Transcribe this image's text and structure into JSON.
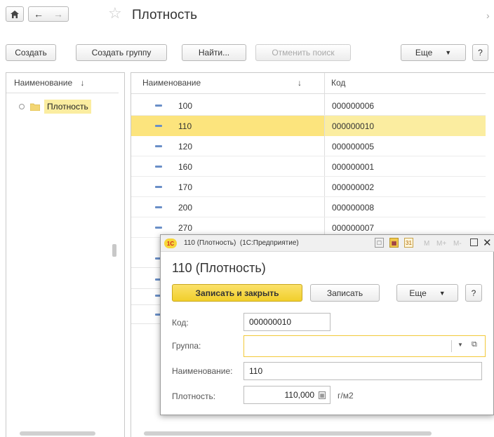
{
  "page": {
    "title": "Плотность"
  },
  "toolbar": {
    "create": "Создать",
    "create_group": "Создать группу",
    "find": "Найти...",
    "cancel_search": "Отменить поиск",
    "more": "Еще",
    "help": "?"
  },
  "tree": {
    "header": "Наименование",
    "sort_icon": "↓",
    "item": "Плотность"
  },
  "list": {
    "header_name": "Наименование",
    "header_sort": "↓",
    "header_code": "Код",
    "rows": [
      {
        "name": "100",
        "code": "000000006"
      },
      {
        "name": "110",
        "code": "000000010"
      },
      {
        "name": "120",
        "code": "000000005"
      },
      {
        "name": "160",
        "code": "000000001"
      },
      {
        "name": "170",
        "code": "000000002"
      },
      {
        "name": "200",
        "code": "000000008"
      },
      {
        "name": "270",
        "code": "000000007"
      }
    ]
  },
  "dialog": {
    "window_title": "110 (Плотность)  (1С:Предприятие)",
    "tb_m": "M",
    "tb_mplus": "M+",
    "tb_mminus": "M-",
    "title": "110 (Плотность)",
    "save_close": "Записать и закрыть",
    "save": "Записать",
    "more": "Еще",
    "help": "?",
    "code_label": "Код:",
    "code_value": "000000010",
    "group_label": "Группа:",
    "group_value": "",
    "name_label": "Наименование:",
    "name_value": "110",
    "density_label": "Плотность:",
    "density_value": "110,000",
    "density_unit": "г/м2",
    "cal_day": "31"
  },
  "colors": {
    "accent": "#fce47d",
    "select_row": "#fbeda0",
    "save_btn": "#f7d93c"
  }
}
